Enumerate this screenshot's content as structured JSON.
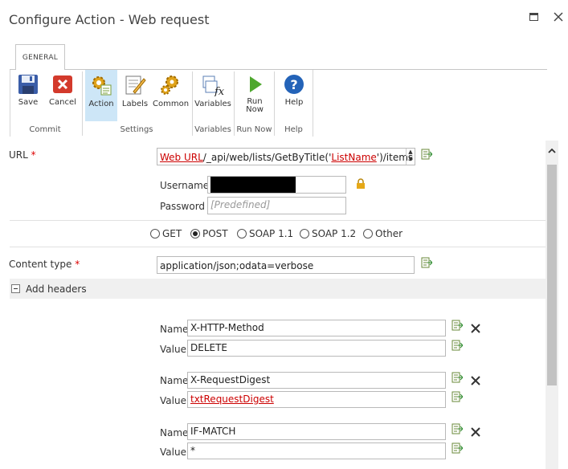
{
  "window": {
    "title": "Configure Action - Web request"
  },
  "ribbon": {
    "tab_label": "GENERAL",
    "buttons": {
      "save": "Save",
      "cancel": "Cancel",
      "action": "Action",
      "labels": "Labels",
      "common": "Common",
      "variables": "Variables",
      "run_now_1": "Run",
      "run_now_2": "Now",
      "help": "Help"
    },
    "groups": {
      "commit": "Commit",
      "settings": "Settings",
      "variables": "Variables",
      "run_now": "Run Now",
      "help": "Help"
    }
  },
  "form": {
    "url_label": "URL",
    "required_mark": "*",
    "url_value": {
      "token1": "Web URL",
      "mid": "/_api/web/lists/GetByTitle('",
      "token2": "ListName",
      "end": "')/items"
    },
    "username_label": "Username",
    "password_label": "Password",
    "password_placeholder": "[Predefined]",
    "methods": [
      "GET",
      "POST",
      "SOAP 1.1",
      "SOAP 1.2",
      "Other"
    ],
    "selected_method": "POST",
    "content_type_label": "Content type",
    "content_type_value": "application/json;odata=verbose",
    "add_headers_label": "Add headers",
    "name_label": "Name",
    "value_label": "Value",
    "headers": [
      {
        "name": "X-HTTP-Method",
        "value": "DELETE",
        "value_is_reference": false
      },
      {
        "name": "X-RequestDigest",
        "value": "txtRequestDigest",
        "value_is_reference": true
      },
      {
        "name": "IF-MATCH",
        "value": "*",
        "value_is_reference": false
      }
    ]
  },
  "colors": {
    "accent_selected": "#cde6f7",
    "required": "#dd0000",
    "reference_link": "#cc0000"
  }
}
